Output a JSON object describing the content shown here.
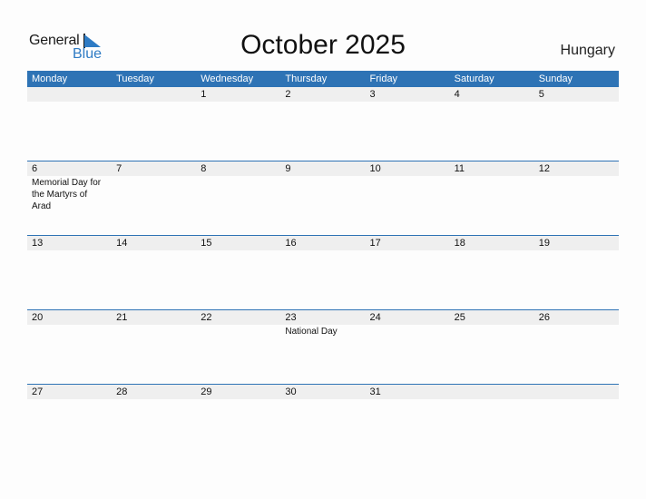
{
  "logo": {
    "general": "General",
    "blue": "Blue"
  },
  "title": "October 2025",
  "country": "Hungary",
  "colors": {
    "header_bg": "#2e73b5",
    "date_row_bg": "#efefef",
    "logo_blue": "#2e7bc4"
  },
  "weekdays": [
    "Monday",
    "Tuesday",
    "Wednesday",
    "Thursday",
    "Friday",
    "Saturday",
    "Sunday"
  ],
  "weeks": [
    {
      "days": [
        "",
        "",
        "1",
        "2",
        "3",
        "4",
        "5"
      ],
      "events": [
        "",
        "",
        "",
        "",
        "",
        "",
        ""
      ]
    },
    {
      "days": [
        "6",
        "7",
        "8",
        "9",
        "10",
        "11",
        "12"
      ],
      "events": [
        "Memorial Day for the Martyrs of Arad",
        "",
        "",
        "",
        "",
        "",
        ""
      ]
    },
    {
      "days": [
        "13",
        "14",
        "15",
        "16",
        "17",
        "18",
        "19"
      ],
      "events": [
        "",
        "",
        "",
        "",
        "",
        "",
        ""
      ]
    },
    {
      "days": [
        "20",
        "21",
        "22",
        "23",
        "24",
        "25",
        "26"
      ],
      "events": [
        "",
        "",
        "",
        "National Day",
        "",
        "",
        ""
      ]
    },
    {
      "days": [
        "27",
        "28",
        "29",
        "30",
        "31",
        "",
        ""
      ],
      "events": [
        "",
        "",
        "",
        "",
        "",
        "",
        ""
      ]
    }
  ]
}
